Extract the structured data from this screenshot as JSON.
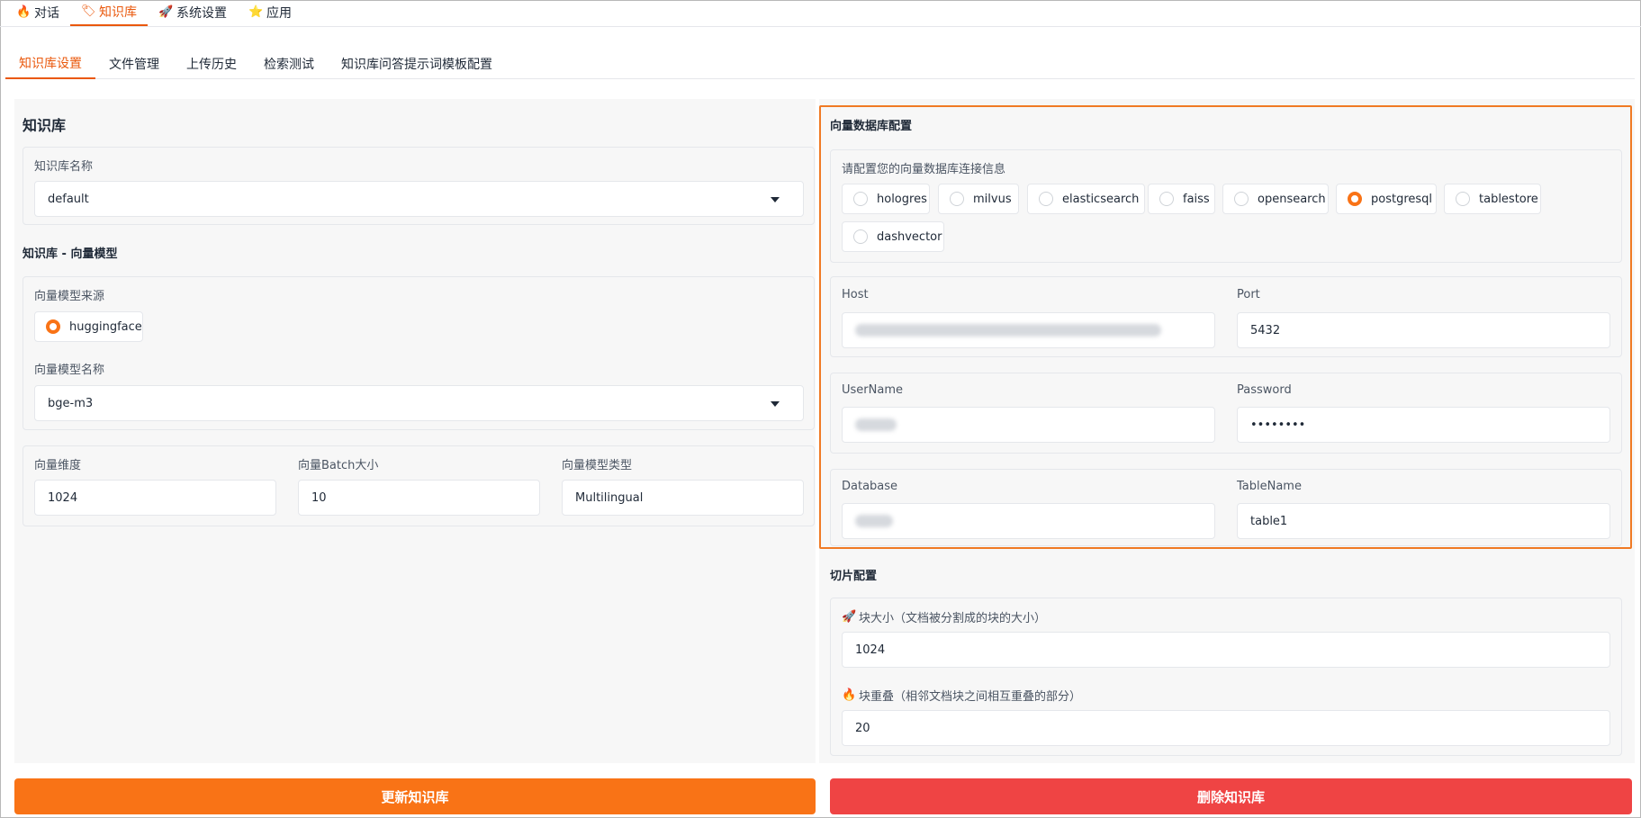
{
  "top_tabs": [
    {
      "label": "对话",
      "icon": "fire-icon"
    },
    {
      "label": "知识库",
      "icon": "tag-icon"
    },
    {
      "label": "系统设置",
      "icon": "rocket-icon"
    },
    {
      "label": "应用",
      "icon": "star-icon"
    }
  ],
  "sub_tabs": [
    "知识库设置",
    "文件管理",
    "上传历史",
    "检索测试",
    "知识库问答提示词模板配置"
  ],
  "left": {
    "title": "知识库",
    "kb_name_label": "知识库名称",
    "kb_name_value": "default",
    "embedding_section_title": "知识库 - 向量模型",
    "model_source_label": "向量模型来源",
    "model_source_option": "huggingface",
    "model_name_label": "向量模型名称",
    "model_name_value": "bge-m3",
    "dim_label": "向量维度",
    "dim_value": "1024",
    "batch_label": "向量Batch大小",
    "batch_value": "10",
    "type_label": "向量模型类型",
    "type_value": "Multilingual"
  },
  "vector_db": {
    "title": "向量数据库配置",
    "hint": "请配置您的向量数据库连接信息",
    "options": [
      "hologres",
      "milvus",
      "elasticsearch",
      "faiss",
      "opensearch",
      "postgresql",
      "tablestore",
      "dashvector"
    ],
    "selected": "postgresql",
    "host_label": "Host",
    "port_label": "Port",
    "port_value": "5432",
    "username_label": "UserName",
    "password_label": "Password",
    "password_value": "••••••••",
    "database_label": "Database",
    "tablename_label": "TableName",
    "tablename_value": "table1"
  },
  "chunk": {
    "title": "切片配置",
    "size_label": "块大小（文档被分割成的块的大小）",
    "size_icon": "rocket-icon",
    "size_value": "1024",
    "overlap_label": "块重叠（相邻文档块之间相互重叠的部分）",
    "overlap_icon": "fire-icon",
    "overlap_value": "20"
  },
  "buttons": {
    "update": "更新知识库",
    "delete": "删除知识库"
  },
  "colors": {
    "accent": "#ea580c",
    "update_button": "#f97316",
    "delete_button": "#ef4444"
  }
}
